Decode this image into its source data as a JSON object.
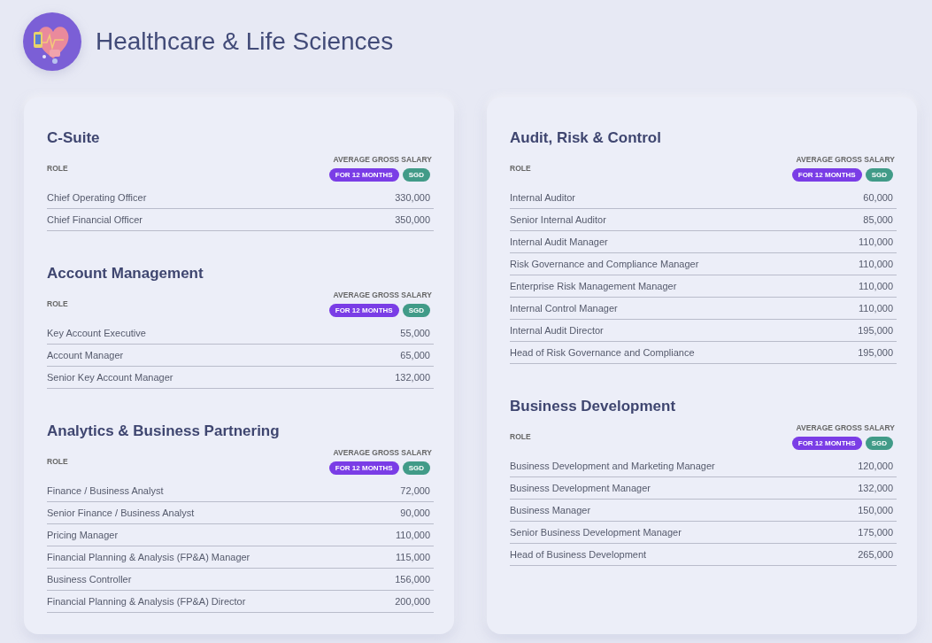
{
  "header": {
    "title": "Healthcare & Life Sciences"
  },
  "columns": [
    {
      "sections": [
        {
          "title": "C-Suite",
          "role_label": "ROLE",
          "salary_label": "AVERAGE GROSS SALARY",
          "badges": [
            {
              "text": "FOR 12 MONTHS",
              "color": "#7a3de6"
            },
            {
              "text": "SGD",
              "color": "#419b88"
            }
          ],
          "rows": [
            {
              "role": "Chief Operating Officer",
              "salary": "330,000"
            },
            {
              "role": "Chief Financial Officer",
              "salary": "350,000"
            }
          ]
        },
        {
          "title": "Account Management",
          "role_label": "ROLE",
          "salary_label": "AVERAGE GROSS SALARY",
          "badges": [
            {
              "text": "FOR 12 MONTHS",
              "color": "#7a3de6"
            },
            {
              "text": "SGD",
              "color": "#419b88"
            }
          ],
          "rows": [
            {
              "role": "Key Account Executive",
              "salary": "55,000"
            },
            {
              "role": "Account Manager",
              "salary": "65,000"
            },
            {
              "role": "Senior Key Account Manager",
              "salary": "132,000"
            }
          ]
        },
        {
          "title": "Analytics & Business Partnering",
          "role_label": "ROLE",
          "salary_label": "AVERAGE GROSS SALARY",
          "badges": [
            {
              "text": "FOR 12 MONTHS",
              "color": "#7a3de6"
            },
            {
              "text": "SGD",
              "color": "#419b88"
            }
          ],
          "rows": [
            {
              "role": "Finance / Business Analyst",
              "salary": "72,000"
            },
            {
              "role": "Senior Finance / Business Analyst",
              "salary": "90,000"
            },
            {
              "role": "Pricing Manager",
              "salary": "110,000"
            },
            {
              "role": "Financial Planning & Analysis (FP&A) Manager",
              "salary": "115,000"
            },
            {
              "role": "Business Controller",
              "salary": "156,000"
            },
            {
              "role": "Financial Planning & Analysis (FP&A) Director",
              "salary": "200,000"
            }
          ]
        }
      ]
    },
    {
      "sections": [
        {
          "title": "Audit, Risk & Control",
          "role_label": "ROLE",
          "salary_label": "AVERAGE GROSS SALARY",
          "badges": [
            {
              "text": "FOR 12 MONTHS",
              "color": "#7a3de6"
            },
            {
              "text": "SGD",
              "color": "#419b88"
            }
          ],
          "rows": [
            {
              "role": "Internal Auditor",
              "salary": "60,000"
            },
            {
              "role": "Senior Internal Auditor",
              "salary": "85,000"
            },
            {
              "role": "Internal Audit Manager",
              "salary": "110,000"
            },
            {
              "role": "Risk Governance and Compliance Manager",
              "salary": "110,000"
            },
            {
              "role": "Enterprise Risk Management Manager",
              "salary": "110,000"
            },
            {
              "role": "Internal Control Manager",
              "salary": "110,000"
            },
            {
              "role": "Internal Audit Director",
              "salary": "195,000"
            },
            {
              "role": "Head of Risk Governance and Compliance",
              "salary": "195,000"
            }
          ]
        },
        {
          "title": "Business Development",
          "role_label": "ROLE",
          "salary_label": "AVERAGE GROSS SALARY",
          "badges": [
            {
              "text": "FOR 12 MONTHS",
              "color": "#7a3de6"
            },
            {
              "text": "SGD",
              "color": "#419b88"
            }
          ],
          "rows": [
            {
              "role": "Business Development and Marketing Manager",
              "salary": "120,000"
            },
            {
              "role": "Business Development Manager",
              "salary": "132,000"
            },
            {
              "role": "Business Manager",
              "salary": "150,000"
            },
            {
              "role": "Senior Business Development Manager",
              "salary": "175,000"
            },
            {
              "role": "Head of Business Development",
              "salary": "265,000"
            }
          ]
        }
      ]
    }
  ]
}
